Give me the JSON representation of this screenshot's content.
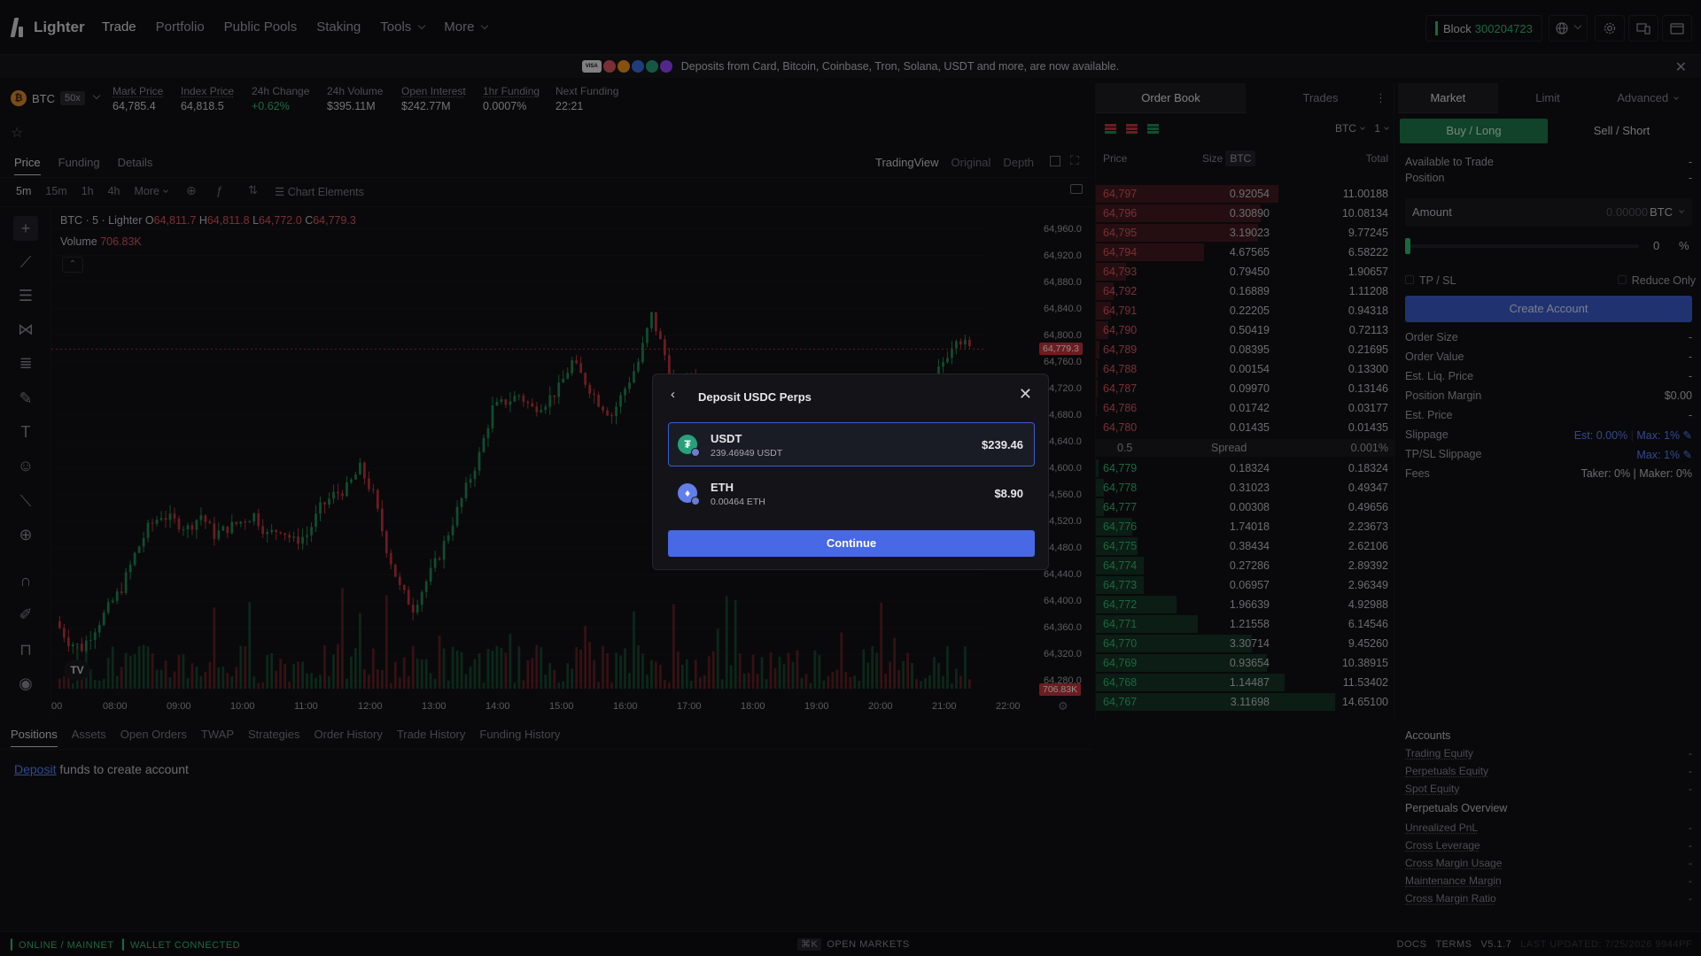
{
  "nav": {
    "logo": "Lighter",
    "links": [
      "Trade",
      "Portfolio",
      "Public Pools",
      "Staking",
      "Tools",
      "More"
    ],
    "block_label": "Block",
    "block_number": "300204723"
  },
  "banner": {
    "text": "Deposits from Card, Bitcoin, Coinbase, Tron, Solana, USDT and more, are now available.",
    "card_label": "VISA"
  },
  "ticker": {
    "symbol": "BTC",
    "coin_glyph": "₿",
    "leverage": "50x",
    "stats": [
      {
        "label": "Mark Price",
        "value": "64,785.4"
      },
      {
        "label": "Index Price",
        "value": "64,818.5"
      },
      {
        "label": "24h Change",
        "value": "+0.62%"
      },
      {
        "label": "24h Volume",
        "value": "$395.11M"
      },
      {
        "label": "Open Interest",
        "value": "$242.77M"
      },
      {
        "label": "1hr Funding",
        "value": "0.0007%"
      },
      {
        "label": "Next Funding",
        "value": "22:21"
      }
    ]
  },
  "chart_tabs": [
    "Price",
    "Funding",
    "Details"
  ],
  "view_tabs": [
    "TradingView",
    "Original",
    "Depth"
  ],
  "timeframes": [
    "5m",
    "15m",
    "1h",
    "4h",
    "More"
  ],
  "chart_elements_label": "Chart Elements",
  "legend": {
    "title": "BTC · 5 · Lighter",
    "o": "64,811.7",
    "h": "64,811.8",
    "l": "64,772.0",
    "c": "64,779.3",
    "volume_label": "Volume",
    "volume_value": "706.83K"
  },
  "chart_data": {
    "type": "candlestick",
    "x_ticks": [
      "00",
      "08:00",
      "09:00",
      "10:00",
      "11:00",
      "12:00",
      "13:00",
      "14:00",
      "15:00",
      "16:00",
      "17:00",
      "18:00",
      "19:00",
      "20:00",
      "21:00",
      "22:00"
    ],
    "y_ticks": [
      "64,960.0",
      "64,920.0",
      "64,880.0",
      "64,840.0",
      "64,800.0",
      "64,760.0",
      "64,720.0",
      "64,680.0",
      "64,640.0",
      "64,600.0",
      "64,560.0",
      "64,520.0",
      "64,480.0",
      "64,440.0",
      "64,400.0",
      "64,360.0",
      "64,320.0",
      "64,280.0"
    ],
    "ylim": [
      64250,
      64990
    ],
    "last_price_tag": "64,779.3",
    "volume_tag": "706.83K",
    "close_path": [
      64370,
      64340,
      64330,
      64360,
      64390,
      64420,
      64470,
      64510,
      64530,
      64520,
      64510,
      64530,
      64500,
      64510,
      64520,
      64530,
      64500,
      64510,
      64490,
      64500,
      64540,
      64560,
      64570,
      64600,
      64560,
      64480,
      64420,
      64390,
      64430,
      64470,
      64520,
      64570,
      64620,
      64690,
      64700,
      64710,
      64690,
      64700,
      64720,
      64760,
      64730,
      64700,
      64680,
      64720,
      64760,
      64830,
      64770,
      64700,
      64740,
      64690,
      64680,
      64700,
      64720,
      64670,
      64650,
      64660,
      64640,
      64650,
      64660,
      64640,
      64620,
      64640,
      64690,
      64660,
      64640,
      64650,
      64720,
      64760,
      64800,
      64779
    ]
  },
  "toolbar_icons": [
    "crosshair-icon",
    "trend-line-icon",
    "horizontal-lines-icon",
    "pattern-icon",
    "fib-icon",
    "brush-icon",
    "text-icon",
    "emoji-icon",
    "ruler-icon",
    "zoom-in-icon",
    "magnet-icon",
    "lock-drawing-icon",
    "lock-icon",
    "eye-icon"
  ],
  "bottom_tabs": [
    "Positions",
    "Assets",
    "Open Orders",
    "TWAP",
    "Strategies",
    "Order History",
    "Trade History",
    "Funding History"
  ],
  "deposit_message": {
    "link": "Deposit",
    "text": " funds to create account"
  },
  "orderbook": {
    "tabs": [
      "Order Book",
      "Trades"
    ],
    "selector": "BTC",
    "step": "1",
    "headers": {
      "price": "Price",
      "size": "Size",
      "unit": "BTC",
      "total": "Total"
    },
    "asks": [
      {
        "price": "64,797",
        "size": "0.92054",
        "total": "11.00188",
        "depth": 0.61
      },
      {
        "price": "64,796",
        "size": "0.30890",
        "total": "10.08134",
        "depth": 0.55
      },
      {
        "price": "64,795",
        "size": "3.19023",
        "total": "9.77245",
        "depth": 0.54
      },
      {
        "price": "64,794",
        "size": "4.67565",
        "total": "6.58222",
        "depth": 0.36
      },
      {
        "price": "64,793",
        "size": "0.79450",
        "total": "1.90657",
        "depth": 0.1
      },
      {
        "price": "64,792",
        "size": "0.16889",
        "total": "1.11208",
        "depth": 0.06
      },
      {
        "price": "64,791",
        "size": "0.22205",
        "total": "0.94318",
        "depth": 0.05
      },
      {
        "price": "64,790",
        "size": "0.50419",
        "total": "0.72113",
        "depth": 0.04
      },
      {
        "price": "64,789",
        "size": "0.08395",
        "total": "0.21695",
        "depth": 0.012
      },
      {
        "price": "64,788",
        "size": "0.00154",
        "total": "0.13300",
        "depth": 0.007
      },
      {
        "price": "64,787",
        "size": "0.09970",
        "total": "0.13146",
        "depth": 0.007
      },
      {
        "price": "64,786",
        "size": "0.01742",
        "total": "0.03177",
        "depth": 0.002
      },
      {
        "price": "64,780",
        "size": "0.01435",
        "total": "0.01435",
        "depth": 0.001
      }
    ],
    "spread": {
      "value": "0.5",
      "label": "Spread",
      "pct": "0.001%"
    },
    "bids": [
      {
        "price": "64,779",
        "size": "0.18324",
        "total": "0.18324",
        "depth": 0.01
      },
      {
        "price": "64,778",
        "size": "0.31023",
        "total": "0.49347",
        "depth": 0.027
      },
      {
        "price": "64,777",
        "size": "0.00308",
        "total": "0.49656",
        "depth": 0.027
      },
      {
        "price": "64,776",
        "size": "1.74018",
        "total": "2.23673",
        "depth": 0.12
      },
      {
        "price": "64,775",
        "size": "0.38434",
        "total": "2.62106",
        "depth": 0.14
      },
      {
        "price": "64,774",
        "size": "0.27286",
        "total": "2.89392",
        "depth": 0.16
      },
      {
        "price": "64,773",
        "size": "0.06957",
        "total": "2.96349",
        "depth": 0.16
      },
      {
        "price": "64,772",
        "size": "1.96639",
        "total": "4.92988",
        "depth": 0.27
      },
      {
        "price": "64,771",
        "size": "1.21558",
        "total": "6.14546",
        "depth": 0.34
      },
      {
        "price": "64,770",
        "size": "3.30714",
        "total": "9.45260",
        "depth": 0.52
      },
      {
        "price": "64,769",
        "size": "0.93654",
        "total": "10.38915",
        "depth": 0.57
      },
      {
        "price": "64,768",
        "size": "1.14487",
        "total": "11.53402",
        "depth": 0.63
      },
      {
        "price": "64,767",
        "size": "3.11698",
        "total": "14.65100",
        "depth": 0.8
      }
    ]
  },
  "trade": {
    "tabs": [
      "Market",
      "Limit",
      "Advanced"
    ],
    "buy_label": "Buy / Long",
    "sell_label": "Sell / Short",
    "available_label": "Available to Trade",
    "available_value": "-",
    "position_label": "Position",
    "position_value": "-",
    "amount_label": "Amount",
    "amount_value": "0.00000",
    "amount_unit": "BTC",
    "slider_value": "0",
    "slider_fraction": 0,
    "slider_unit": "%",
    "tpsl_label": "TP / SL",
    "reduce_label": "Reduce Only",
    "create_label": "Create Account",
    "details": [
      {
        "label": "Order Size",
        "value": "-"
      },
      {
        "label": "Order Value",
        "value": "-"
      },
      {
        "label": "Est. Liq. Price",
        "value": "-"
      },
      {
        "label": "Position Margin",
        "value": "$0.00"
      },
      {
        "label": "Est. Price",
        "value": "-"
      }
    ],
    "slippage_label": "Slippage",
    "slippage_est": "Est: 0.00%",
    "slippage_max": "Max: 1%",
    "tpsl_slippage_label": "TP/SL Slippage",
    "tpsl_slippage_max": "Max: 1%",
    "fees_label": "Fees",
    "fees_value": "Taker: 0% | Maker: 0%"
  },
  "accounts": {
    "title": "Accounts",
    "rows": [
      {
        "label": "Trading Equity",
        "value": "-"
      },
      {
        "label": "Perpetuals Equity",
        "value": "-"
      },
      {
        "label": "Spot Equity",
        "value": "-"
      }
    ],
    "overview_title": "Perpetuals Overview",
    "overview_rows": [
      {
        "label": "Unrealized PnL",
        "value": "-"
      },
      {
        "label": "Cross Leverage",
        "value": "-"
      },
      {
        "label": "Cross Margin Usage",
        "value": "-"
      },
      {
        "label": "Maintenance Margin",
        "value": "-"
      },
      {
        "label": "Cross Margin Ratio",
        "value": "-"
      }
    ]
  },
  "footer": {
    "status1": "ONLINE / MAINNET",
    "status2": "WALLET CONNECTED",
    "open_markets_key": "⌘K",
    "open_markets": "OPEN MARKETS",
    "docs": "DOCS",
    "terms": "TERMS",
    "version": "V5.1.7",
    "last_updated": "LAST UPDATED: 7/25/2026 9944PF"
  },
  "modal": {
    "title": "Deposit USDC Perps",
    "assets": [
      {
        "name": "USDT",
        "balance": "239.46949 USDT",
        "value": "$239.46",
        "color": "#26a17b",
        "icon": "tether-icon"
      },
      {
        "name": "ETH",
        "balance": "0.00464 ETH",
        "value": "$8.90",
        "color": "#627eea",
        "icon": "ethereum-icon"
      }
    ],
    "continue_label": "Continue"
  }
}
